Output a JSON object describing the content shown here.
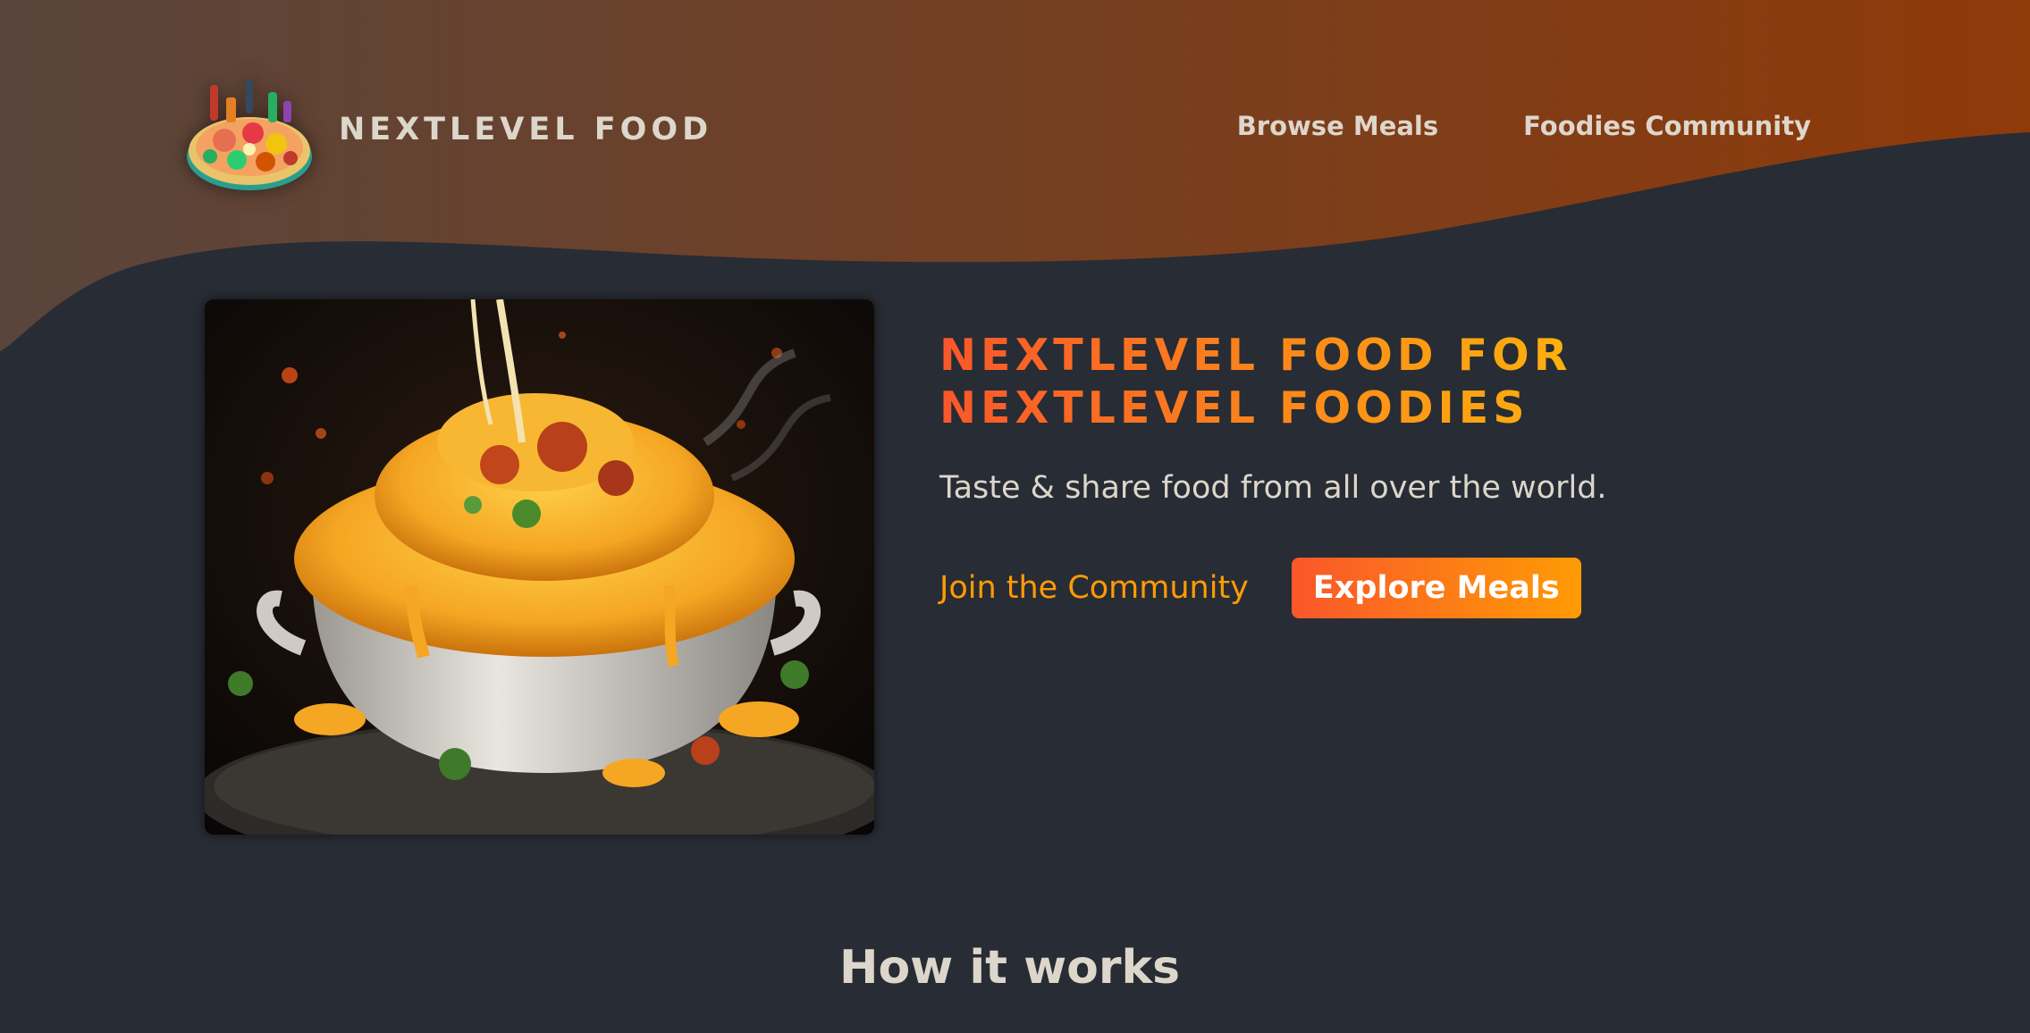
{
  "brand": {
    "name": "NEXTLEVEL FOOD",
    "logo_icon": "food-platter-icon"
  },
  "nav": {
    "items": [
      {
        "label": "Browse Meals"
      },
      {
        "label": "Foodies Community"
      }
    ]
  },
  "hero": {
    "image_icon": "mac-and-cheese-photo",
    "title_line1": "NEXTLEVEL FOOD FOR",
    "title_line2": "NEXTLEVEL FOODIES",
    "subtitle": "Taste & share food from all over the world.",
    "join_label": "Join the Community",
    "explore_label": "Explore Meals"
  },
  "section": {
    "title": "How it works"
  },
  "colors": {
    "background": "#282c34",
    "header_gradient_start": "#59453c",
    "header_gradient_end": "#8f3a09",
    "accent_orange": "#f9572a",
    "accent_yellow": "#ffc905",
    "link_orange": "#ff9b05",
    "text_light": "#ddd6cb"
  }
}
